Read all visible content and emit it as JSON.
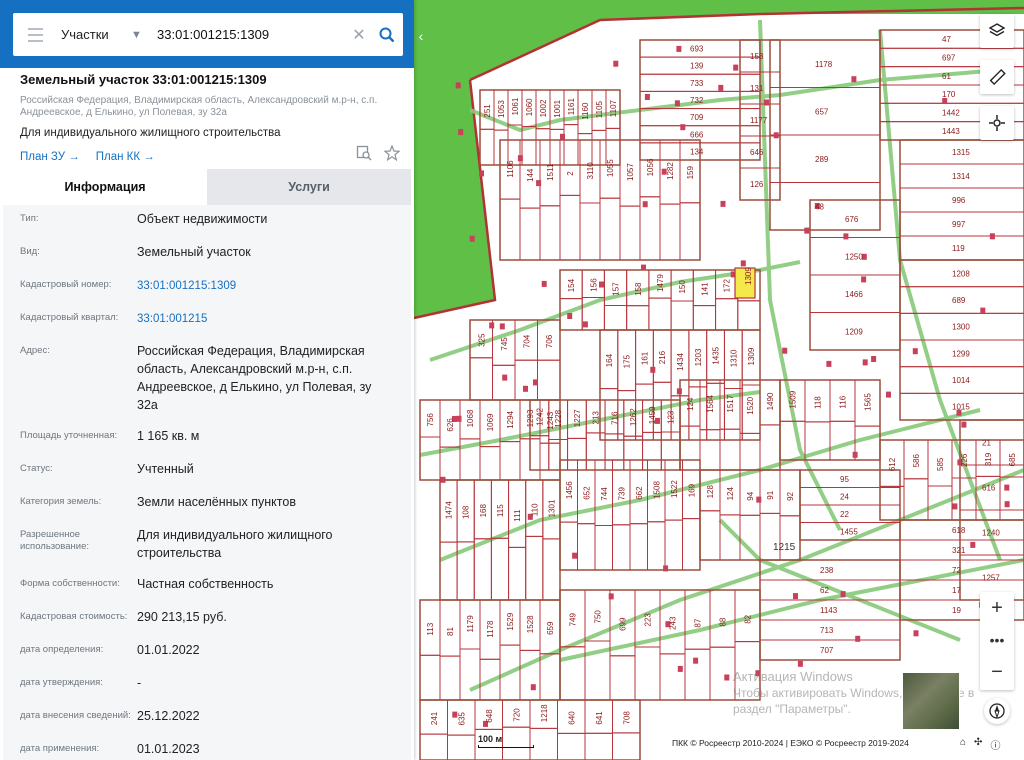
{
  "search": {
    "scope": "Участки",
    "query": "33:01:001215:1309"
  },
  "header": {
    "title": "Земельный участок 33:01:001215:1309",
    "address_small": "Российская Федерация, Владимирская область, Александровский м.р-н, с.п. Андреевское, д Елькино, ул Полевая, зу 32а",
    "purpose": "Для индивидуального жилищного строительства",
    "link_plan_zu": "План ЗУ →",
    "link_plan_kk": "План КК →"
  },
  "tabs": {
    "info": "Информация",
    "services": "Услуги"
  },
  "fields": [
    {
      "label": "Тип:",
      "value": "Объект недвижимости"
    },
    {
      "label": "Вид:",
      "value": "Земельный участок"
    },
    {
      "label": "Кадастровый номер:",
      "value": "33:01:001215:1309",
      "link": true
    },
    {
      "label": "Кадастровый квартал:",
      "value": "33:01:001215",
      "link": true
    },
    {
      "label": "Адрес:",
      "value": "Российская Федерация, Владимирская область, Александровский м.р-н, с.п. Андреевское, д Елькино, ул Полевая, зу 32а"
    },
    {
      "label": "Площадь уточненная:",
      "value": "1 165 кв. м"
    },
    {
      "label": "Статус:",
      "value": "Учтенный"
    },
    {
      "label": "Категория земель:",
      "value": "Земли населённых пунктов"
    },
    {
      "label": "Разрешенное использование:",
      "value": "Для индивидуального жилищного строительства"
    },
    {
      "label": "Форма собственности:",
      "value": "Частная собственность"
    },
    {
      "label": "Кадастровая стоимость:",
      "value": "290 213,15 руб."
    },
    {
      "label": "дата определения:",
      "value": "01.01.2022"
    },
    {
      "label": "дата утверждения:",
      "value": "-"
    },
    {
      "label": "дата внесения сведений:",
      "value": "25.12.2022"
    },
    {
      "label": "дата применения:",
      "value": "01.01.2023"
    }
  ],
  "map": {
    "block_label": "1215",
    "scale": "100 м",
    "attribution": "ПКК © Росреестр 2010-2024 | ЕЭКО © Росреестр 2019-2024",
    "watermark_line1": "Активация Windows",
    "watermark_line2": "Чтобы активировать Windows, перейдите в",
    "watermark_line3": "раздел \"Параметры\".",
    "parcel_labels": [
      "251",
      "1053",
      "1061",
      "1060",
      "1002",
      "1001",
      "1161",
      "1160",
      "1105",
      "1107",
      "1106",
      "144",
      "1511",
      "2",
      "3110",
      "1055",
      "1057",
      "1056",
      "1282",
      "159",
      "154",
      "156",
      "157",
      "158",
      "1479",
      "150",
      "141",
      "172",
      "694",
      "164",
      "175",
      "161",
      "216",
      "1434",
      "1203",
      "1435",
      "1310",
      "1309",
      "693",
      "139",
      "733",
      "732",
      "709",
      "666",
      "134",
      "158",
      "131",
      "1177",
      "646",
      "126",
      "1178",
      "657",
      "289",
      "48",
      "47",
      "697",
      "61",
      "170",
      "1442",
      "1443",
      "1315",
      "1314",
      "996",
      "997",
      "119",
      "676",
      "1250",
      "1466",
      "1209",
      "1208",
      "689",
      "1300",
      "1299",
      "1014",
      "1015",
      "325",
      "745",
      "704",
      "706",
      "756",
      "626",
      "1068",
      "1069",
      "1294",
      "1293",
      "1243",
      "1242",
      "1228",
      "1227",
      "213",
      "716",
      "1262",
      "1459",
      "123",
      "124",
      "1564",
      "1517",
      "1520",
      "1490",
      "1509",
      "118",
      "116",
      "1565",
      "1474",
      "108",
      "168",
      "115",
      "111",
      "110",
      "1301",
      "1456",
      "652",
      "744",
      "739",
      "662",
      "1508",
      "1522",
      "169",
      "128",
      "124",
      "94",
      "91",
      "92",
      "95",
      "24",
      "22",
      "1455",
      "113",
      "81",
      "1179",
      "1178",
      "1529",
      "1528",
      "659",
      "749",
      "750",
      "699",
      "223",
      "243",
      "87",
      "88",
      "82",
      "238",
      "62",
      "1143",
      "713",
      "707",
      "241",
      "635",
      "648",
      "720",
      "1218",
      "640",
      "641",
      "708",
      "612",
      "586",
      "585",
      "226",
      "319",
      "685",
      "618",
      "321",
      "72",
      "17",
      "19",
      "21",
      "616",
      "1240",
      "1257",
      "1000",
      "84"
    ]
  }
}
